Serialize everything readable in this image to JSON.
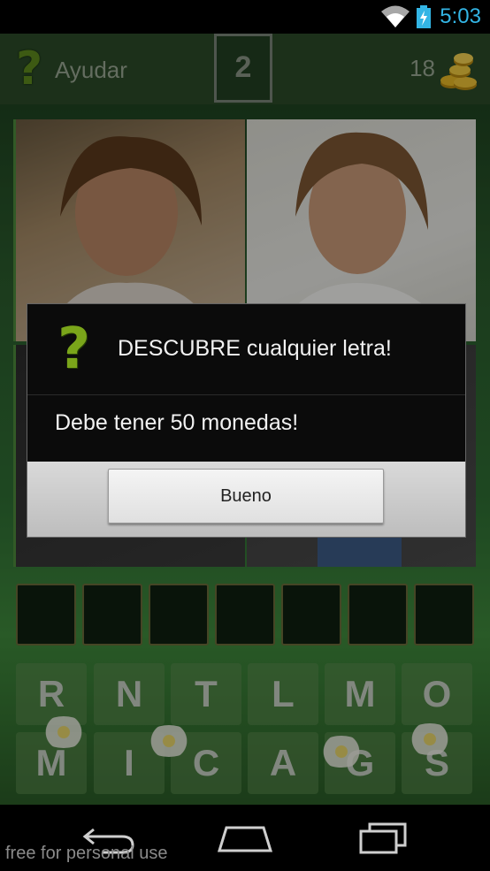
{
  "status_bar": {
    "time": "5:03",
    "icons": [
      "wifi-icon",
      "battery-charging-icon"
    ],
    "accent_color": "#33b5e5"
  },
  "header": {
    "help_icon": "question-mark-icon",
    "help_label": "Ayudar",
    "level": "2",
    "coins": "18",
    "coins_icon": "gold-coins-icon"
  },
  "letter_slots_count": 7,
  "keyboard": {
    "row1": [
      "R",
      "N",
      "T",
      "L",
      "M",
      "O"
    ],
    "row2": [
      "M",
      "I",
      "C",
      "A",
      "G",
      "S"
    ]
  },
  "dialog": {
    "icon": "question-mark-icon",
    "title": "DESCUBRE cualquier letra!",
    "message": "Debe tener 50 monedas!",
    "button_label": "Bueno"
  },
  "navbar": {
    "icons": [
      "back-icon",
      "home-icon",
      "recents-icon"
    ]
  },
  "watermark": "free for personal use"
}
